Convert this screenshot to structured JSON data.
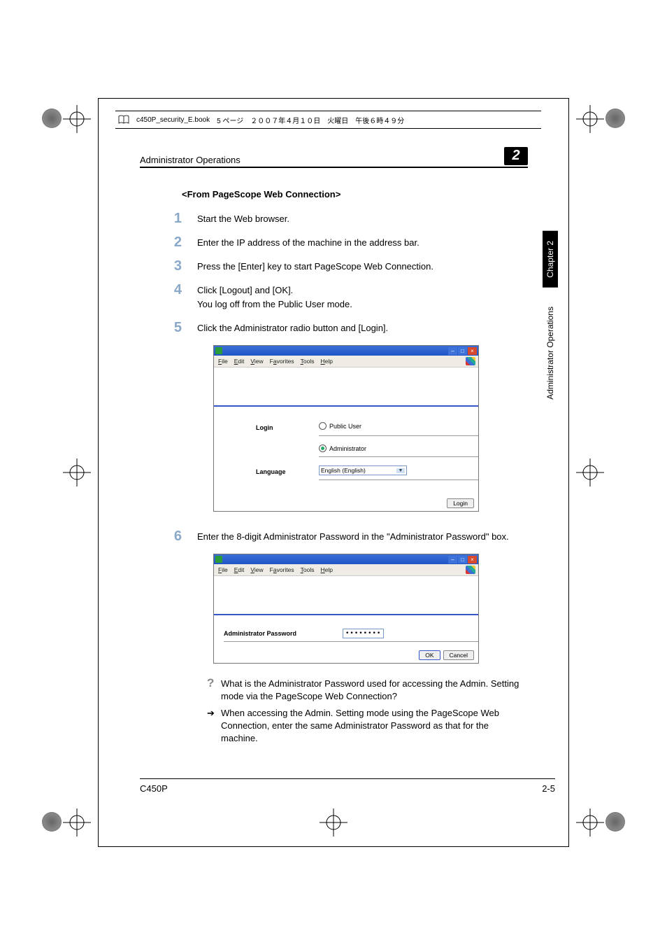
{
  "header_strip": {
    "filename": "c450P_security_E.book",
    "page_jp": "5 ページ",
    "date_jp": "２００７年４月１０日",
    "weekday_jp": "火曜日",
    "time_jp": "午後６時４９分"
  },
  "section": {
    "title": "Administrator Operations",
    "number": "2"
  },
  "subhead": "<From PageScope Web Connection>",
  "steps": [
    {
      "num": "1",
      "text": "Start the Web browser."
    },
    {
      "num": "2",
      "text": "Enter the IP address of the machine in the address bar."
    },
    {
      "num": "3",
      "text": "Press the [Enter] key to start PageScope Web Connection."
    },
    {
      "num": "4",
      "text": "Click [Logout] and [OK].",
      "text2": "You log off from the Public User mode."
    },
    {
      "num": "5",
      "text": "Click the Administrator radio button and [Login]."
    },
    {
      "num": "6",
      "text": "Enter the 8-digit Administrator Password in the \"Administrator Password\" box."
    }
  ],
  "screenshot1": {
    "menus": [
      "File",
      "Edit",
      "View",
      "Favorites",
      "Tools",
      "Help"
    ],
    "login_label": "Login",
    "public_user": "Public User",
    "administrator": "Administrator",
    "language_label": "Language",
    "language_value": "English (English)",
    "login_button": "Login"
  },
  "screenshot2": {
    "menus": [
      "File",
      "Edit",
      "View",
      "Favorites",
      "Tools",
      "Help"
    ],
    "pw_label": "Administrator Password",
    "pw_value": "••••••••",
    "ok": "OK",
    "cancel": "Cancel"
  },
  "qa": {
    "question": "What is the Administrator Password used for accessing the Admin. Setting mode via the PageScope Web Connection?",
    "answer": "When accessing the Admin. Setting mode using the PageScope Web Connection, enter the same Administrator Password as that for the machine."
  },
  "side": {
    "chapter": "Chapter 2",
    "label": "Administrator Operations"
  },
  "footer": {
    "model": "C450P",
    "page": "2-5"
  }
}
